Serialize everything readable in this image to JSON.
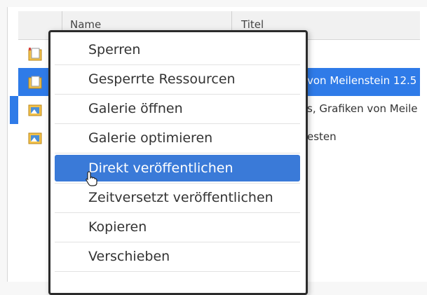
{
  "header": {
    "name_label": "Name",
    "title_label": "Titel"
  },
  "rows": [
    {
      "icon": "folder-page-icon",
      "title": "",
      "selected": false
    },
    {
      "icon": "folder-page-icon",
      "title": "von Meilenstein 12.5",
      "selected": true
    },
    {
      "icon": "gallery-icon",
      "title": "s, Grafiken von Meile",
      "selected": false
    },
    {
      "icon": "gallery-icon",
      "title": "esten",
      "selected": false
    }
  ],
  "context_menu": {
    "items": [
      {
        "label": "Sperren"
      },
      {
        "label": "Gesperrte Ressourcen"
      },
      {
        "label": "Galerie öffnen"
      },
      {
        "label": "Galerie optimieren"
      },
      {
        "label": "Direkt veröffentlichen",
        "active": true
      },
      {
        "label": "Zeitversetzt veröffentlichen"
      },
      {
        "label": "Kopieren"
      },
      {
        "label": "Verschieben"
      }
    ]
  },
  "colors": {
    "accent": "#2f7be8",
    "menu_highlight": "#3a7ad8",
    "menu_border": "#2b2b2b"
  }
}
